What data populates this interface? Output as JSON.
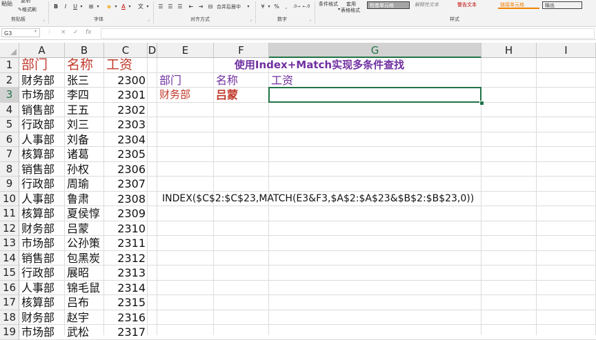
{
  "ribbon": {
    "clipboard": {
      "paste": "粘贴",
      "copy": "复制",
      "format_painter": "格式刷",
      "label": "剪贴板"
    },
    "font": {
      "bold": "B",
      "italic": "I",
      "underline": "U",
      "font_color_glyph": "A",
      "wen": "文",
      "label": "字体"
    },
    "alignment": {
      "merge_center": "合并后居中",
      "label": "对齐方式"
    },
    "number": {
      "currency": "¥",
      "percent": "%",
      "thousands": ",",
      "label": "数字"
    },
    "styles": {
      "conditional_format": "条件格式",
      "format_table_line1": "套用",
      "format_table_line2": "表格格式",
      "check_cell": "检查单元格",
      "explanatory": "解释性文本",
      "warning": "警告文本",
      "linked_cell": "链接单元格",
      "output": "输出",
      "label": "样式"
    }
  },
  "formula_bar": {
    "name_box": "G3",
    "cancel": "×",
    "enter": "✓",
    "fx": "fx",
    "value": ""
  },
  "columns": [
    "A",
    "B",
    "C",
    "D",
    "E",
    "F",
    "G",
    "H",
    "I"
  ],
  "rows": [
    "1",
    "2",
    "3",
    "4",
    "5",
    "6",
    "7",
    "8",
    "9",
    "10",
    "11",
    "12",
    "13",
    "14",
    "15",
    "16",
    "17",
    "18",
    "19"
  ],
  "headers": {
    "dept": "部门",
    "name": "名称",
    "salary": "工资"
  },
  "table": [
    {
      "dept": "财务部",
      "name": "张三",
      "salary": "2300"
    },
    {
      "dept": "市场部",
      "name": "李四",
      "salary": "2301"
    },
    {
      "dept": "销售部",
      "name": "王五",
      "salary": "2302"
    },
    {
      "dept": "行政部",
      "name": "刘三",
      "salary": "2303"
    },
    {
      "dept": "人事部",
      "name": "刘备",
      "salary": "2304"
    },
    {
      "dept": "核算部",
      "name": "诸葛",
      "salary": "2305"
    },
    {
      "dept": "销售部",
      "name": "孙权",
      "salary": "2306"
    },
    {
      "dept": "行政部",
      "name": "周瑜",
      "salary": "2307"
    },
    {
      "dept": "人事部",
      "name": "鲁肃",
      "salary": "2308"
    },
    {
      "dept": "核算部",
      "name": "夏侯惇",
      "salary": "2309"
    },
    {
      "dept": "财务部",
      "name": "吕蒙",
      "salary": "2310"
    },
    {
      "dept": "市场部",
      "name": "公孙策",
      "salary": "2311"
    },
    {
      "dept": "销售部",
      "name": "包黑炭",
      "salary": "2312"
    },
    {
      "dept": "行政部",
      "name": "展昭",
      "salary": "2313"
    },
    {
      "dept": "人事部",
      "name": "锦毛鼠",
      "salary": "2314"
    },
    {
      "dept": "核算部",
      "name": "吕布",
      "salary": "2315"
    },
    {
      "dept": "财务部",
      "name": "赵宇",
      "salary": "2316"
    },
    {
      "dept": "市场部",
      "name": "武松",
      "salary": "2317"
    }
  ],
  "lookup": {
    "title": "使用Index+Match实现多条件查找",
    "dept_label": "部门",
    "name_label": "名称",
    "salary_label": "工资",
    "dept_value": "财务部",
    "name_value": "吕蒙",
    "formula_text": "INDEX($C$2:$C$23,MATCH(E3&F3,$A$2:$A$23&$B$2:$B$23,0))"
  },
  "selected_cell": "G3",
  "colors": {
    "header_red": "#c0392b",
    "title_purple": "#7030a0",
    "input_red": "#c0392b",
    "selection_green": "#217346",
    "warning_text": "#c00000",
    "linked_text": "#f08000"
  }
}
